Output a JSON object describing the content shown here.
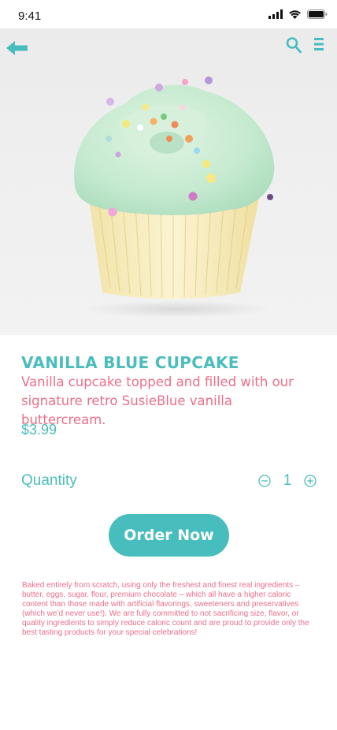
{
  "status_bar": {
    "time": "9:41"
  },
  "icons": {
    "back": "arrow-left-icon",
    "search": "search-icon",
    "menu": "menu-icon",
    "minus": "minus-circle-icon",
    "plus": "plus-circle-icon",
    "signal": "signal-icon",
    "wifi": "wifi-icon",
    "battery": "battery-icon"
  },
  "colors": {
    "accent_teal": "#4cbcbc",
    "accent_pink": "#ec6f88",
    "button_bg": "#48bdbd"
  },
  "product": {
    "title": "VANILLA BLUE CUPCAKE",
    "description": "Vanilla cupcake topped and filled with our signature retro SusieBlue vanilla buttercream.",
    "price": "$3.99"
  },
  "quantity": {
    "label": "Quantity",
    "value": "1"
  },
  "order_button": {
    "label": "Order Now"
  },
  "fine_print": "Baked entirely from scratch, using only the freshest and finest real ingredients – butter, eggs, sugar, flour, premium chocolate – which all have a higher caloric content than those made with artificial flavorings, sweeteners and preservatives (which we’d never use!). We are fully committed to not sacrificing size, flavor, or quality ingredients to simply reduce caloric count and are proud to provide only the best tasting products for your special celebrations!"
}
